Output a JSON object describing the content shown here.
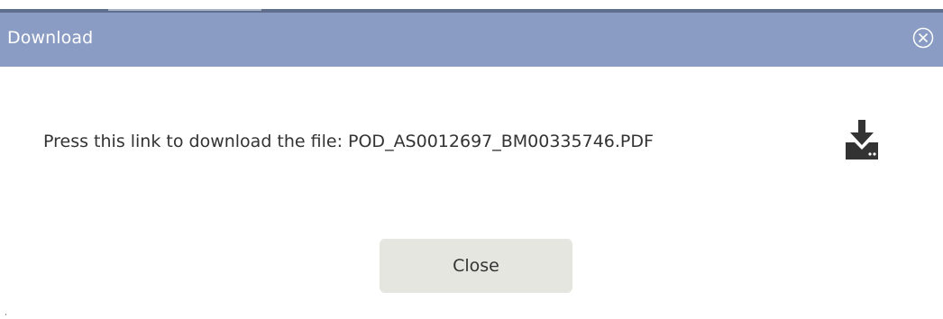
{
  "dialog": {
    "title": "Download",
    "message": "Press this link to download the file: POD_AS0012697_BM00335746.PDF",
    "close_button_label": "Close"
  },
  "icons": {
    "title_close": "close-circle-icon",
    "download": "download-icon"
  },
  "colors": {
    "title_bar": "#8a9cc4",
    "title_text": "#ffffff",
    "button_bg": "#e6e6e1",
    "text": "#333333",
    "icon": "#333333"
  }
}
